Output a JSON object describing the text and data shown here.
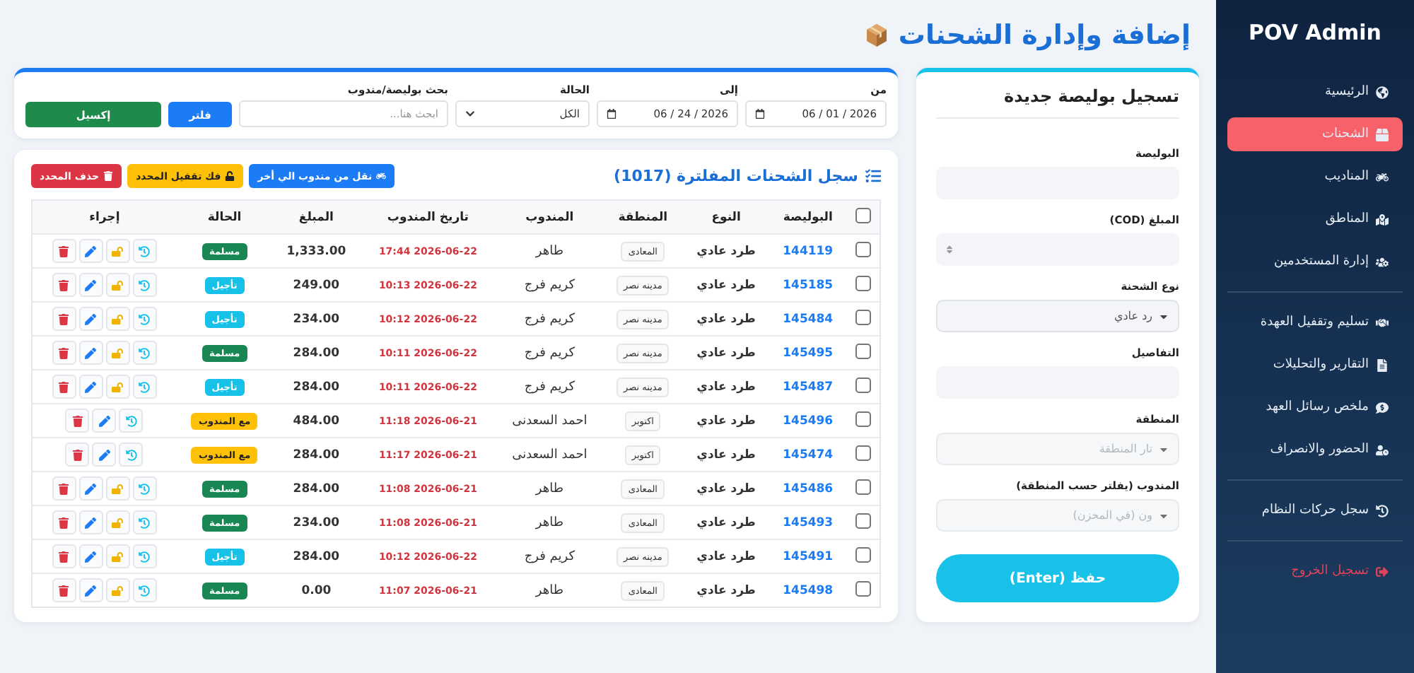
{
  "sidebar": {
    "brand": "POV Admin",
    "items": [
      {
        "label": "الرئيسية",
        "selected": false,
        "divider_after": false,
        "danger": false
      },
      {
        "label": "الشحنات",
        "selected": true,
        "divider_after": false,
        "danger": false
      },
      {
        "label": "المناديب",
        "selected": false,
        "divider_after": false,
        "danger": false
      },
      {
        "label": "المناطق",
        "selected": false,
        "divider_after": false,
        "danger": false
      },
      {
        "label": "إدارة المستخدمين",
        "selected": false,
        "divider_after": true,
        "danger": false
      },
      {
        "label": "تسليم وتقفيل العهدة",
        "selected": false,
        "divider_after": false,
        "danger": false
      },
      {
        "label": "التقارير والتحليلات",
        "selected": false,
        "divider_after": false,
        "danger": false
      },
      {
        "label": "ملخص رسائل العهد",
        "selected": false,
        "divider_after": false,
        "danger": false
      },
      {
        "label": "الحضور والانصراف",
        "selected": false,
        "divider_after": true,
        "danger": false
      },
      {
        "label": "سجل حركات النظام",
        "selected": false,
        "divider_after": true,
        "danger": false
      },
      {
        "label": "تسجيل الخروج",
        "selected": false,
        "divider_after": false,
        "danger": true
      }
    ]
  },
  "page_title": "إضافة وإدارة الشحنات",
  "form": {
    "title": "تسجيل بوليصة جديدة",
    "fields": [
      {
        "kind": "input",
        "label": "البوليصة"
      },
      {
        "kind": "number",
        "label": "المبلغ (COD)"
      },
      {
        "kind": "select",
        "label": "نوع الشحنة",
        "value": "رد عادي"
      },
      {
        "kind": "input",
        "label": "التفاصيل"
      },
      {
        "kind": "select",
        "label": "المنطقة",
        "placeholder": "تار المنطقة",
        "disabled": true
      },
      {
        "kind": "select",
        "label": "المندوب (يفلتر حسب المنطقة)",
        "placeholder": "ون (في المخزن)",
        "disabled": true
      }
    ],
    "submit": "حفظ (Enter)"
  },
  "filters": {
    "from": {
      "label": "من",
      "value": "06 / 01 / 2026"
    },
    "to": {
      "label": "إلى",
      "value": "06 / 24 / 2026"
    },
    "status": {
      "label": "الحالة",
      "value": "الكل"
    },
    "search": {
      "label": "بحث بوليصة/مندوب",
      "placeholder": "ابحث هنا..."
    },
    "buttons": [
      {
        "label": "فلتر",
        "kind": "primary"
      },
      {
        "label": "إكسيل",
        "kind": "success"
      }
    ]
  },
  "table": {
    "title": "سجل الشحنات المفلترة (1017)",
    "actions": [
      {
        "label": "نقل من مندوب الي أخر",
        "kind": "primary"
      },
      {
        "label": "فك تقفيل المحدد",
        "kind": "warning"
      },
      {
        "label": "حذف المحدد",
        "kind": "danger"
      }
    ],
    "all_selected": false,
    "columns": [
      "البوليصة",
      "النوع",
      "المنطقة",
      "المندوب",
      "تاريخ المندوب",
      "المبلغ",
      "الحالة",
      "إجراء"
    ],
    "rows": [
      {
        "selected": false,
        "waybill": "144119",
        "type": "طرد عادي",
        "area": "المعادى",
        "agent": "طاهر",
        "date": "2026-06-22 17:44",
        "amount": "1,333.00",
        "status": "مسلمة",
        "kind": "delivered",
        "lockable": true
      },
      {
        "selected": false,
        "waybill": "145185",
        "type": "طرد عادي",
        "area": "مدينه نصر",
        "agent": "كريم فرج",
        "date": "2026-06-22 10:13",
        "amount": "249.00",
        "status": "تأجيل",
        "kind": "postponed",
        "lockable": true
      },
      {
        "selected": false,
        "waybill": "145484",
        "type": "طرد عادي",
        "area": "مدينه نصر",
        "agent": "كريم فرج",
        "date": "2026-06-22 10:12",
        "amount": "234.00",
        "status": "تأجيل",
        "kind": "postponed",
        "lockable": true
      },
      {
        "selected": false,
        "waybill": "145495",
        "type": "طرد عادي",
        "area": "مدينه نصر",
        "agent": "كريم فرج",
        "date": "2026-06-22 10:11",
        "amount": "284.00",
        "status": "مسلمة",
        "kind": "delivered",
        "lockable": true
      },
      {
        "selected": false,
        "waybill": "145487",
        "type": "طرد عادي",
        "area": "مدينه نصر",
        "agent": "كريم فرج",
        "date": "2026-06-22 10:11",
        "amount": "284.00",
        "status": "تأجيل",
        "kind": "postponed",
        "lockable": true
      },
      {
        "selected": false,
        "waybill": "145496",
        "type": "طرد عادي",
        "area": "اكتوبر",
        "agent": "احمد السعدنى",
        "date": "2026-06-21 11:18",
        "amount": "484.00",
        "status": "مع المندوب",
        "kind": "with_agent",
        "lockable": false
      },
      {
        "selected": false,
        "waybill": "145474",
        "type": "طرد عادي",
        "area": "اكتوبر",
        "agent": "احمد السعدنى",
        "date": "2026-06-21 11:17",
        "amount": "284.00",
        "status": "مع المندوب",
        "kind": "with_agent",
        "lockable": false
      },
      {
        "selected": false,
        "waybill": "145486",
        "type": "طرد عادي",
        "area": "المعادى",
        "agent": "طاهر",
        "date": "2026-06-21 11:08",
        "amount": "284.00",
        "status": "مسلمة",
        "kind": "delivered",
        "lockable": true
      },
      {
        "selected": false,
        "waybill": "145493",
        "type": "طرد عادي",
        "area": "المعادى",
        "agent": "طاهر",
        "date": "2026-06-21 11:08",
        "amount": "234.00",
        "status": "مسلمة",
        "kind": "delivered",
        "lockable": true
      },
      {
        "selected": false,
        "waybill": "145491",
        "type": "طرد عادي",
        "area": "مدينه نصر",
        "agent": "كريم فرج",
        "date": "2026-06-22 10:12",
        "amount": "284.00",
        "status": "تأجيل",
        "kind": "postponed",
        "lockable": true
      },
      {
        "selected": false,
        "waybill": "145498",
        "type": "طرد عادي",
        "area": "المعادى",
        "agent": "طاهر",
        "date": "2026-06-21 11:07",
        "amount": "0.00",
        "status": "مسلمة",
        "kind": "delivered",
        "lockable": true
      }
    ]
  }
}
